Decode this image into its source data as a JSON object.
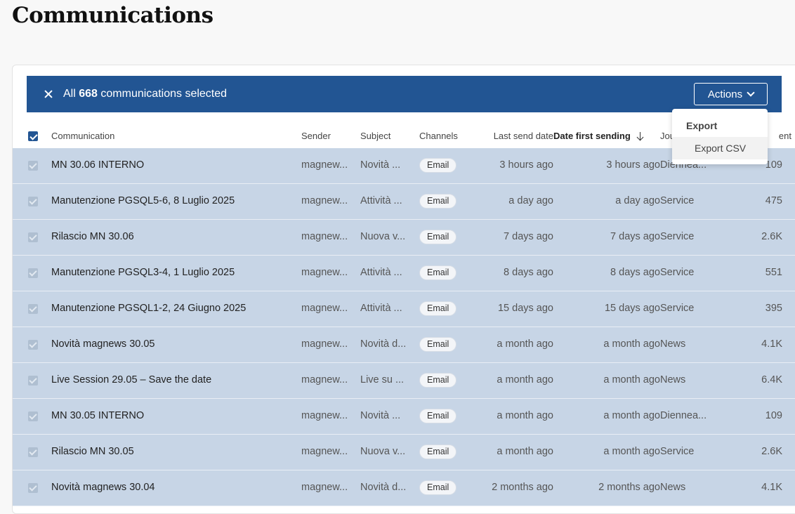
{
  "page": {
    "title": "Communications"
  },
  "selection": {
    "prefix": "All",
    "count": "668",
    "suffix": "communications selected",
    "actions_label": "Actions"
  },
  "columns": {
    "communication": "Communication",
    "sender": "Sender",
    "subject": "Subject",
    "channels": "Channels",
    "last_send_date": "Last send date",
    "date_first_sending": "Date first sending",
    "journey": "Jou",
    "sent": "ent"
  },
  "dropdown": {
    "group_label": "Export",
    "item_label": "Export CSV"
  },
  "rows": [
    {
      "communication": "MN 30.06 INTERNO",
      "sender": "magnew...",
      "subject": "Novità ...",
      "channel": "Email",
      "last_send": "3 hours ago",
      "first_send": "3 hours ago",
      "journey": "Diennea...",
      "sent": "109"
    },
    {
      "communication": "Manutenzione PGSQL5-6, 8 Luglio 2025",
      "sender": "magnew...",
      "subject": "Attività ...",
      "channel": "Email",
      "last_send": "a day ago",
      "first_send": "a day ago",
      "journey": "Service",
      "sent": "475"
    },
    {
      "communication": "Rilascio MN 30.06",
      "sender": "magnew...",
      "subject": "Nuova v...",
      "channel": "Email",
      "last_send": "7 days ago",
      "first_send": "7 days ago",
      "journey": "Service",
      "sent": "2.6K"
    },
    {
      "communication": "Manutenzione PGSQL3-4, 1 Luglio 2025",
      "sender": "magnew...",
      "subject": "Attività ...",
      "channel": "Email",
      "last_send": "8 days ago",
      "first_send": "8 days ago",
      "journey": "Service",
      "sent": "551"
    },
    {
      "communication": "Manutenzione PGSQL1-2, 24 Giugno 2025",
      "sender": "magnew...",
      "subject": "Attività ...",
      "channel": "Email",
      "last_send": "15 days ago",
      "first_send": "15 days ago",
      "journey": "Service",
      "sent": "395"
    },
    {
      "communication": "Novità magnews 30.05",
      "sender": "magnew...",
      "subject": "Novità d...",
      "channel": "Email",
      "last_send": "a month ago",
      "first_send": "a month ago",
      "journey": "News",
      "sent": "4.1K"
    },
    {
      "communication": "Live Session 29.05 – Save the date",
      "sender": "magnew...",
      "subject": "Live su ...",
      "channel": "Email",
      "last_send": "a month ago",
      "first_send": "a month ago",
      "journey": "News",
      "sent": "6.4K"
    },
    {
      "communication": "MN 30.05 INTERNO",
      "sender": "magnew...",
      "subject": "Novità ...",
      "channel": "Email",
      "last_send": "a month ago",
      "first_send": "a month ago",
      "journey": "Diennea...",
      "sent": "109"
    },
    {
      "communication": "Rilascio MN 30.05",
      "sender": "magnew...",
      "subject": "Nuova v...",
      "channel": "Email",
      "last_send": "a month ago",
      "first_send": "a month ago",
      "journey": "Service",
      "sent": "2.6K"
    },
    {
      "communication": "Novità magnews 30.04",
      "sender": "magnew...",
      "subject": "Novità d...",
      "channel": "Email",
      "last_send": "2 months ago",
      "first_send": "2 months ago",
      "journey": "News",
      "sent": "4.1K"
    }
  ]
}
